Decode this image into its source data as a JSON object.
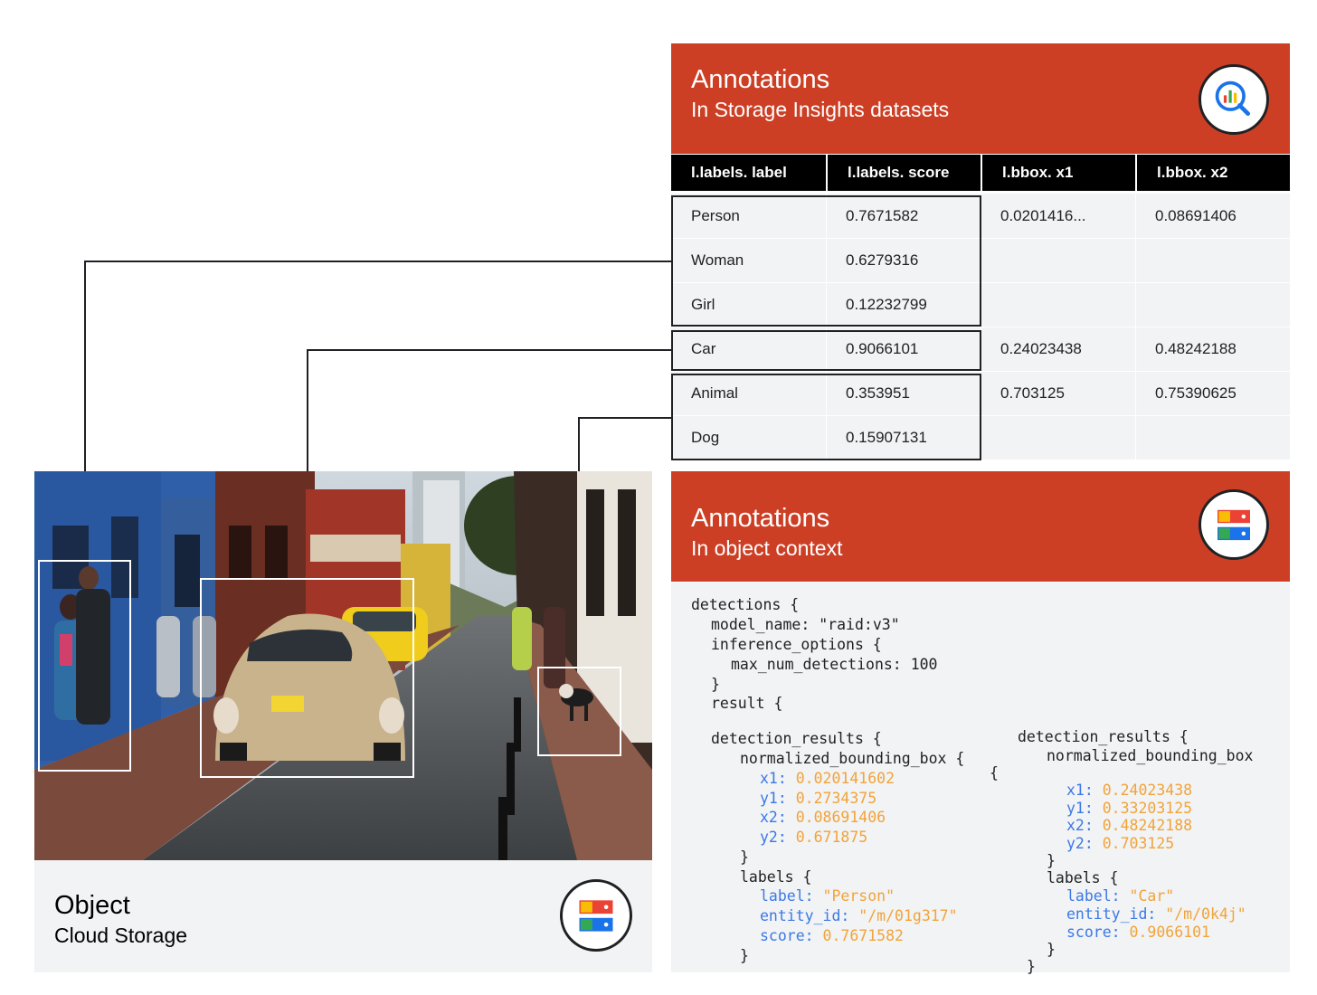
{
  "storage_insights": {
    "title": "Annotations",
    "subtitle": "In Storage Insights datasets",
    "icon": "insights-magnifier-chart-icon",
    "columns": [
      "l.labels. label",
      "l.labels. score",
      "l.bbox. x1",
      "l.bbox. x2"
    ],
    "rows": [
      {
        "label": "Person",
        "score": "0.7671582",
        "x1": "0.0201416...",
        "x2": "0.08691406"
      },
      {
        "label": "Woman",
        "score": "0.6279316",
        "x1": "",
        "x2": ""
      },
      {
        "label": "Girl",
        "score": "0.12232799",
        "x1": "",
        "x2": ""
      },
      {
        "label": "Car",
        "score": "0.9066101",
        "x1": "0.24023438",
        "x2": "0.48242188"
      },
      {
        "label": "Animal",
        "score": "0.353951",
        "x1": "0.703125",
        "x2": "0.75390625"
      },
      {
        "label": "Dog",
        "score": "0.15907131",
        "x1": "",
        "x2": ""
      }
    ]
  },
  "object": {
    "title": "Object",
    "subtitle": "Cloud Storage",
    "icon": "cloud-storage-icon",
    "image_description_icon": "street-photo-with-detection-boxes"
  },
  "object_context": {
    "title": "Annotations",
    "subtitle": "In object context",
    "icon": "cloud-storage-icon",
    "code_header": {
      "detections": "detections {",
      "model_name_key": "model_name:",
      "model_name_val": "\"raid:v3\"",
      "inference_options": "inference_options {",
      "max_key": "max_num_detections:",
      "max_val": "100",
      "close": "}",
      "result": "result {"
    },
    "results": [
      {
        "open": "detection_results {",
        "bbox_open": "normalized_bounding_box {",
        "bbox": [
          {
            "k": "x1:",
            "v": "0.020141602"
          },
          {
            "k": "y1:",
            "v": "0.2734375"
          },
          {
            "k": "x2:",
            "v": "0.08691406"
          },
          {
            "k": "y2:",
            "v": "0.671875"
          }
        ],
        "labels_open": "labels {",
        "labels": [
          {
            "k": "label:",
            "v": "\"Person\""
          },
          {
            "k": "entity_id:",
            "v": "\"/m/01g317\""
          },
          {
            "k": "score:",
            "v": "0.7671582"
          }
        ]
      },
      {
        "open": "detection_results {",
        "bbox_open": "normalized_bounding_box",
        "bbox": [
          {
            "k": "x1:",
            "v": "0.24023438"
          },
          {
            "k": "y1:",
            "v": "0.33203125"
          },
          {
            "k": "x2:",
            "v": "0.48242188"
          },
          {
            "k": "y2:",
            "v": "0.703125"
          }
        ],
        "labels_open": "labels {",
        "labels": [
          {
            "k": "label:",
            "v": "\"Car\""
          },
          {
            "k": "entity_id:",
            "v": "\"/m/0k4j\""
          },
          {
            "k": "score:",
            "v": "0.9066101"
          }
        ]
      }
    ]
  }
}
